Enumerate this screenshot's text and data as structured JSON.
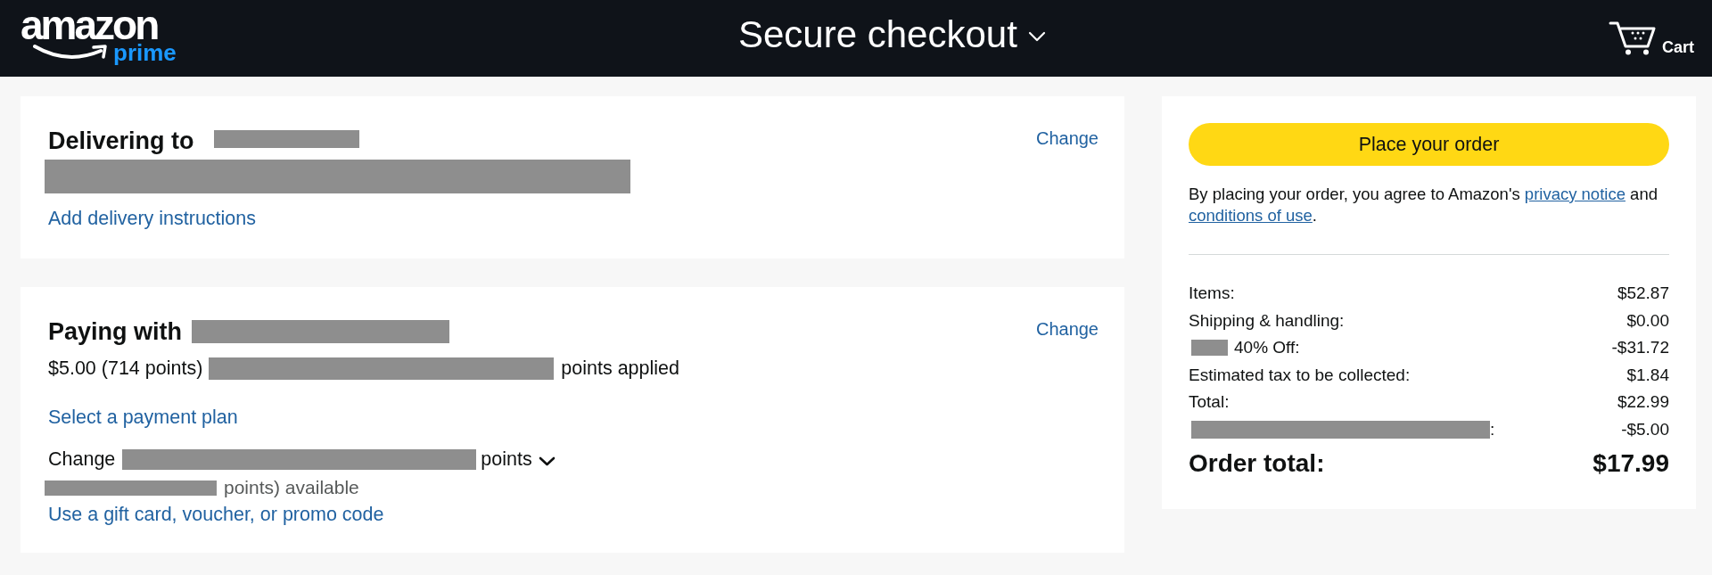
{
  "header": {
    "logo": {
      "wordmark": "amazon",
      "badge": "prime"
    },
    "title": "Secure checkout",
    "cart": "Cart"
  },
  "delivery": {
    "title": "Delivering to",
    "name_redacted": true,
    "address_redacted": true,
    "change": "Change",
    "link": "Add delivery instructions"
  },
  "payment": {
    "title": "Paying with",
    "method_redacted": true,
    "change": "Change",
    "applied": {
      "amount": "$5.00 (714 points)",
      "redacted": true,
      "suffix": "points applied"
    },
    "plan_link": "Select a payment plan",
    "points_select": {
      "prefix": "Change",
      "redacted": true,
      "suffix": "points"
    },
    "available": {
      "redacted": true,
      "text": "points) available"
    },
    "promo_link": "Use a gift card, voucher, or promo code"
  },
  "summary": {
    "button": "Place your order",
    "agreement": [
      {
        "kind": "text",
        "text": "By placing your order, you agree to Amazon's "
      },
      {
        "kind": "link",
        "text": "privacy notice"
      },
      {
        "kind": "text",
        "text": " and "
      },
      {
        "kind": "link",
        "text": "conditions of use"
      },
      {
        "kind": "text",
        "text": "."
      }
    ],
    "rows": [
      {
        "label": "Items:",
        "value": "$52.87",
        "redacted": false
      },
      {
        "label": "Shipping & handling:",
        "value": "$0.00",
        "redacted": false
      },
      {
        "label": "40% Off:",
        "value": "-$31.72",
        "redacted": true
      },
      {
        "label": "Estimated tax to be collected:",
        "value": "$1.84",
        "redacted": false
      },
      {
        "label": "Total:",
        "value": "$22.99",
        "redacted": false
      },
      {
        "label": ":",
        "value": "-$5.00",
        "redacted": true
      }
    ],
    "order_total": {
      "label": "Order total:",
      "value": "$17.99"
    }
  }
}
